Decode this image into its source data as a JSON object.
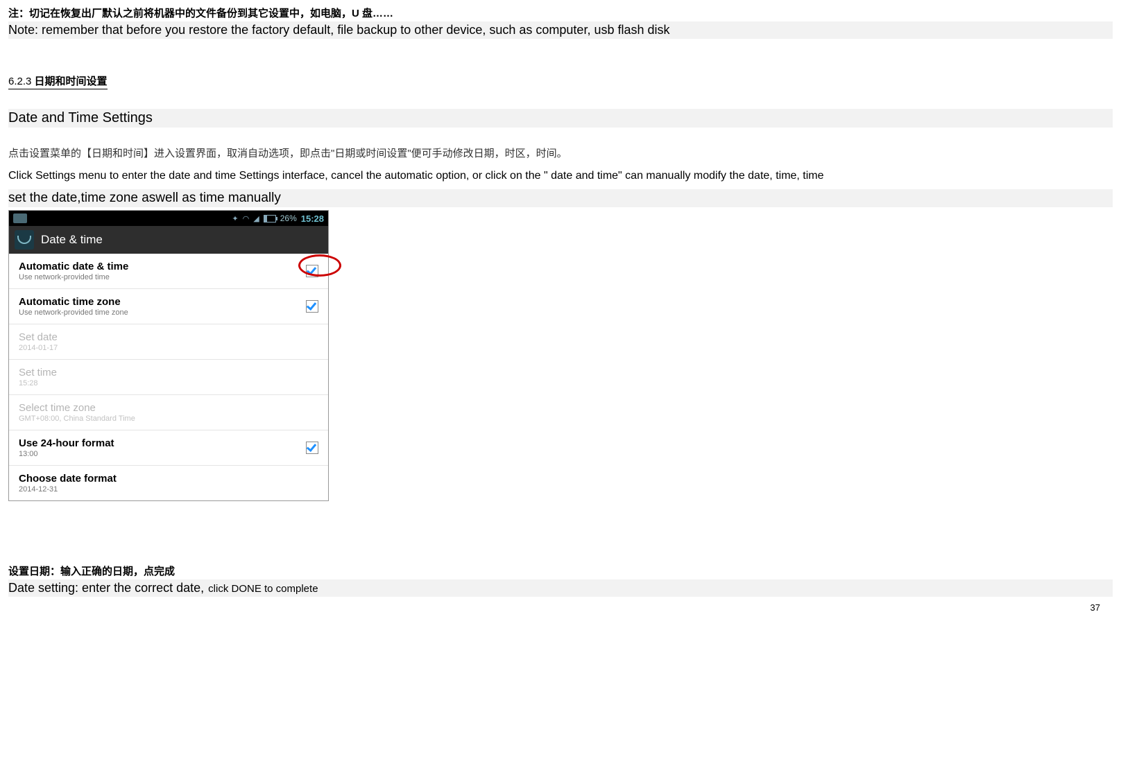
{
  "note": {
    "cn": "注：切记在恢复出厂默认之前将机器中的文件备份到其它设置中，如电脑，U 盘……",
    "en": "Note: remember that before you restore the factory default, file backup to other device, such as computer, usb flash disk"
  },
  "section": {
    "number": "6.2.3",
    "title_cn": "日期和时间设置",
    "title_en": "Date and Time Settings"
  },
  "paragraph": {
    "cn": "点击设置菜单的【日期和时间】进入设置界面，取消自动选项，即点击\"日期或时间设置\"便可手动修改日期，时区，时间。",
    "en1": "Click Settings menu to enter the date and time Settings interface, cancel the automatic option, or click on the \" date and time\" can manually modify the date, time, time",
    "en2": "set the date,time zone aswell as time manually"
  },
  "phone": {
    "statusbar": {
      "bluetooth_icon": "bluetooth-icon",
      "wifi_icon": "wifi-icon",
      "signal_icon": "signal-icon",
      "battery_percent": "26%",
      "time": "15:28"
    },
    "titlebar": {
      "icon": "settings-date-icon",
      "title": "Date & time"
    },
    "rows": [
      {
        "primary": "Automatic date & time",
        "secondary": "Use network-provided time",
        "checked": true,
        "enabled": true,
        "highlighted": true
      },
      {
        "primary": "Automatic time zone",
        "secondary": "Use network-provided time zone",
        "checked": true,
        "enabled": true
      },
      {
        "primary": "Set date",
        "secondary": "2014-01-17",
        "enabled": false
      },
      {
        "primary": "Set time",
        "secondary": "15:28",
        "enabled": false
      },
      {
        "primary": "Select time zone",
        "secondary": "GMT+08:00, China Standard Time",
        "enabled": false
      },
      {
        "primary": "Use 24-hour format",
        "secondary": "13:00",
        "checked": true,
        "enabled": true
      },
      {
        "primary": "Choose date format",
        "secondary": "2014-12-31",
        "enabled": true
      }
    ]
  },
  "bottom": {
    "cn": "设置日期：输入正确的日期，点完成",
    "en1": "Date setting: enter the correct date,",
    "en2": "click DONE to complete"
  },
  "page_number": "37"
}
